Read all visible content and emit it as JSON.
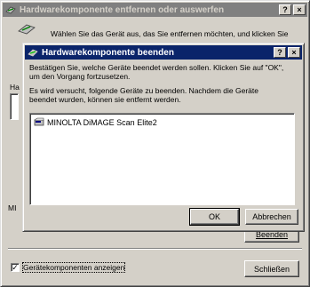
{
  "outer_window": {
    "title": "Hardwarekomponente entfernen oder auswerfen",
    "help_button": "?",
    "close_button": "×",
    "instruction": "Wählen Sie das Gerät aus, das Sie entfernen möchten, und klicken Sie",
    "list_label": "Ha",
    "device_label_partial": "MI",
    "stop_button": "Beenden",
    "checkbox_label": "Gerätekomponenten anzeigen",
    "checkbox_checked": true,
    "close_dialog_button": "Schließen"
  },
  "inner_dialog": {
    "title": "Hardwarekomponente beenden",
    "help_button": "?",
    "close_button": "×",
    "line1": "Bestätigen Sie, welche Geräte beendet werden sollen. Klicken Sie auf \"OK\",",
    "line2": "um den Vorgang fortzusetzen.",
    "line3": "Es wird versucht, folgende Geräte zu beenden. Nachdem die Geräte",
    "line4": "beendet wurden, können sie entfernt werden.",
    "devices": [
      "MINOLTA DiMAGE Scan Elite2"
    ],
    "ok_button": "OK",
    "cancel_button": "Abbrechen"
  }
}
